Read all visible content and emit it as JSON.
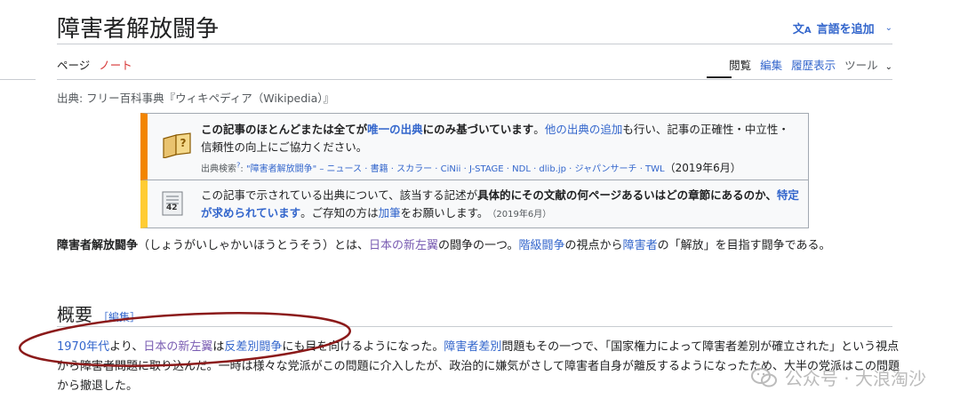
{
  "header": {
    "title": "障害者解放闘争",
    "lang_button": "言語を追加",
    "lang_icon": "translate-icon"
  },
  "tabs": {
    "page": "ページ",
    "talk": "ノート",
    "read": "閲覧",
    "edit": "編集",
    "history": "履歴表示",
    "tools": "ツール"
  },
  "source_line": "出典: フリー百科事典『ウィキペディア（Wikipedia）』",
  "ambox1": {
    "bold1": "この記事のほとんどまたは全てが",
    "link1": "唯一の出典",
    "bold2": "にのみ基づいています",
    "text1": "。",
    "link2": "他の出典の追加",
    "text2": "も行い、記事の正確性・中立性・信頼性の向上にご協力ください。",
    "search_label": "出典検索",
    "search_q": "?",
    "search_links": "\"障害者解放闘争\" – ニュース · 書籍 · スカラー · CiNii · J-STAGE · NDL · dlib.jp · ジャパンサーチ · TWL",
    "date": "（2019年6月）"
  },
  "ambox2": {
    "text1": "この記事で示されている出典について、該当する記述が",
    "bold1": "具体的にその文献の何ページあるいはどの章節にあるのか、",
    "link1": "特定が求められています",
    "text2": "。ご存知の方は",
    "link2": "加筆",
    "text3": "をお願いします。",
    "date": "（2019年6月）",
    "icon_number": "42"
  },
  "lead": {
    "bold": "障害者解放闘争",
    "t1": "（しょうがいしゃかいほうとうそう）とは、",
    "l1": "日本の新左翼",
    "t2": "の闘争の一つ。",
    "l2": "階級闘争",
    "t3": "の視点から",
    "l3": "障害者",
    "t4": "の「解放」を目指す闘争である。"
  },
  "section": {
    "title": "概要",
    "edit": "［編集］"
  },
  "para2": {
    "l1": "1970年代",
    "t1": "より、",
    "l2": "日本の新左翼",
    "t2": "は",
    "l3": "反差別闘争",
    "t3": "にも目を向けるようになった。",
    "l4": "障害者差別",
    "t4": "問題もその一つで、「国家権力によって障害者差別が確立された」という視点から障害者問題に取り込んだ。一時は様々な党派がこの問題に介入したが、政治的に嫌気がさして障害者自身が離反するようになったため、大半の党派はこの問題から撤退した。"
  },
  "watermark": {
    "text": "公众号 · 大浪淘沙",
    "icon": "wechat-icon"
  },
  "colors": {
    "link": "#3366cc",
    "visited": "#795cb2",
    "annotation": "#8b1a1a",
    "ambox_orange": "#f28500",
    "ambox_yellow": "#ffcc33"
  }
}
